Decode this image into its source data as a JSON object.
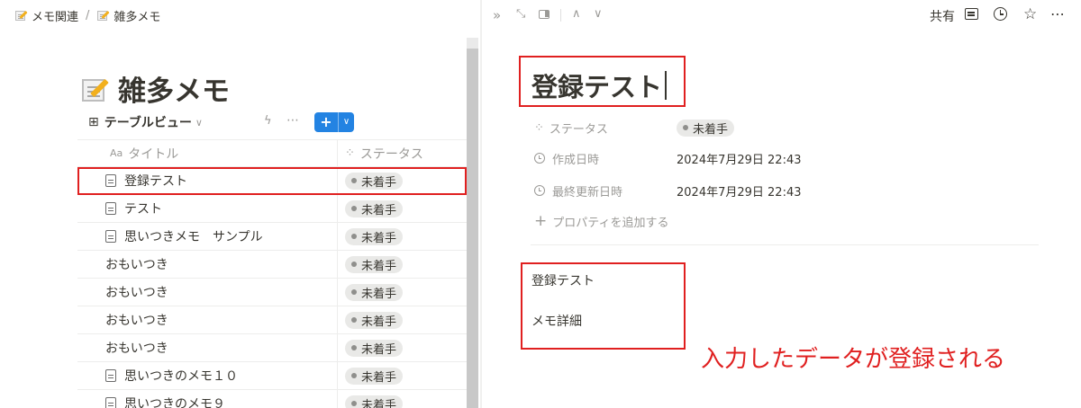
{
  "breadcrumb": {
    "parent": "メモ関連",
    "separator": "/",
    "current": "雑多メモ"
  },
  "page": {
    "title": "雑多メモ"
  },
  "view": {
    "icon": "table-grid-icon",
    "name": "テーブルビュー",
    "new_button_icon": "plus-icon"
  },
  "table": {
    "columns": {
      "title": "タイトル",
      "title_prefix": "Aa",
      "status": "ステータス"
    },
    "rows": [
      {
        "title": "登録テスト",
        "has_doc_icon": true,
        "status": "未着手"
      },
      {
        "title": "テスト",
        "has_doc_icon": true,
        "status": "未着手"
      },
      {
        "title": "思いつきメモ　サンプル",
        "has_doc_icon": true,
        "status": "未着手"
      },
      {
        "title": "おもいつき",
        "has_doc_icon": false,
        "status": "未着手"
      },
      {
        "title": "おもいつき",
        "has_doc_icon": false,
        "status": "未着手"
      },
      {
        "title": "おもいつき",
        "has_doc_icon": false,
        "status": "未着手"
      },
      {
        "title": "おもいつき",
        "has_doc_icon": false,
        "status": "未着手"
      },
      {
        "title": "思いつきのメモ１０",
        "has_doc_icon": true,
        "status": "未着手"
      },
      {
        "title": "思いつきのメモ９",
        "has_doc_icon": true,
        "status": "未着手"
      }
    ]
  },
  "peek": {
    "toolbar": {
      "share": "共有"
    },
    "title": "登録テスト",
    "properties": [
      {
        "name": "ステータス",
        "value": "未着手",
        "icon": "status-spinner-icon"
      },
      {
        "name": "作成日時",
        "value": "2024年7月29日 22:43",
        "icon": "clock-icon"
      },
      {
        "name": "最終更新日時",
        "value": "2024年7月29日 22:43",
        "icon": "clock-icon"
      }
    ],
    "add_property": "プロパティを追加する",
    "body": [
      "登録テスト",
      "メモ詳細"
    ]
  },
  "annotation": "入力したデータが登録される",
  "colors": {
    "accent": "#2383e2",
    "highlight": "#e02020",
    "status_pill": "#e9e9e7"
  }
}
